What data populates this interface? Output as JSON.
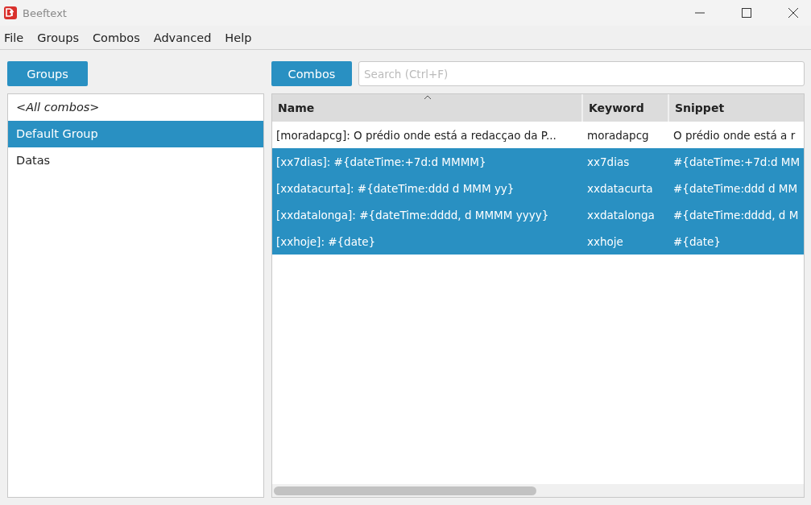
{
  "window": {
    "title": "Beeftext"
  },
  "menu": [
    "File",
    "Groups",
    "Combos",
    "Advanced",
    "Help"
  ],
  "groups_button": "Groups",
  "groups": [
    {
      "label": "<All combos>",
      "kind": "all",
      "selected": false
    },
    {
      "label": "Default Group",
      "kind": "group",
      "selected": true
    },
    {
      "label": "Datas",
      "kind": "group",
      "selected": false
    }
  ],
  "combos_button": "Combos",
  "search": {
    "placeholder": "Search (Ctrl+F)"
  },
  "table": {
    "columns": [
      "Name",
      "Keyword",
      "Snippet"
    ],
    "rows": [
      {
        "cells": [
          "[moradapcg]: O prédio onde está a redacçao da P...",
          "moradapcg",
          "O prédio onde está a r"
        ],
        "selected": false
      },
      {
        "cells": [
          "[xx7dias]: #{dateTime:+7d:d MMMM}",
          "xx7dias",
          "#{dateTime:+7d:d MM"
        ],
        "selected": true
      },
      {
        "cells": [
          "[xxdatacurta]: #{dateTime:ddd d MMM yy}",
          "xxdatacurta",
          "#{dateTime:ddd d MM"
        ],
        "selected": true
      },
      {
        "cells": [
          "[xxdatalonga]: #{dateTime:dddd, d MMMM yyyy}",
          "xxdatalonga",
          "#{dateTime:dddd, d M"
        ],
        "selected": true
      },
      {
        "cells": [
          "[xxhoje]: #{date}",
          "xxhoje",
          "#{date}"
        ],
        "selected": true
      }
    ]
  }
}
